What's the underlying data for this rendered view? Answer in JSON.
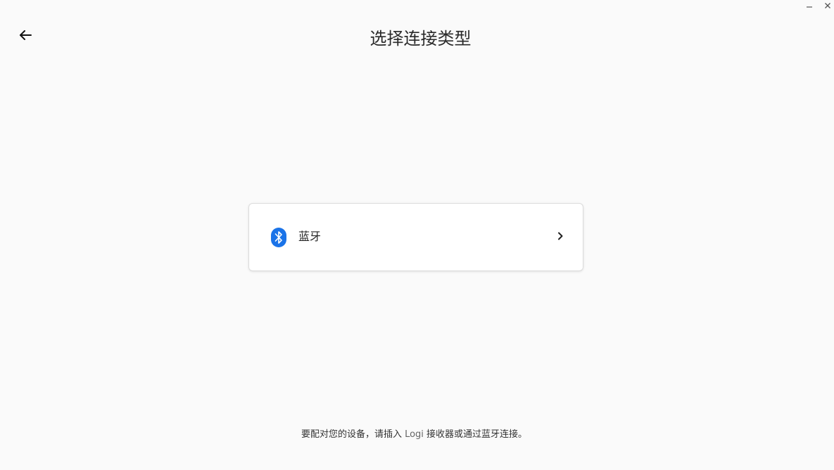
{
  "window": {
    "controls": [
      {
        "name": "minimize",
        "icon": "minimize-icon"
      },
      {
        "name": "close",
        "icon": "close-icon"
      }
    ]
  },
  "header": {
    "back_icon": "arrow-left-icon",
    "title": "选择连接类型"
  },
  "options": [
    {
      "label": "蓝牙",
      "icon": "bluetooth-icon",
      "icon_color": "#1a73e8",
      "chevron_icon": "chevron-right-icon"
    }
  ],
  "footer": {
    "hint_before": "要配对您的设备，请插入 ",
    "hint_brand": "Logi",
    "hint_after": " 接收器或通过蓝牙连接。"
  }
}
